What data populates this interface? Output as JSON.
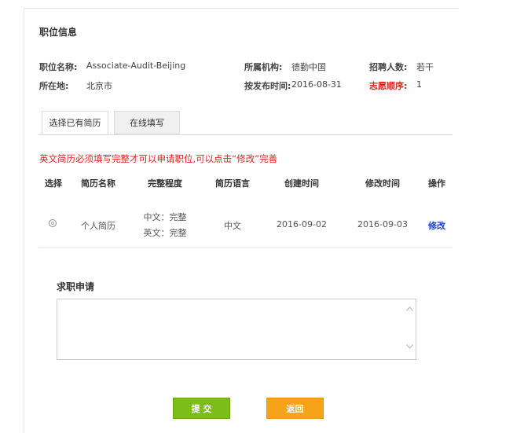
{
  "position_info": {
    "title": "职位信息",
    "name_label": "职位名称:",
    "name_value": "Associate-Audit-Beijing",
    "org_label": "所属机构:",
    "org_value": "德勤中国",
    "headcount_label": "招聘人数:",
    "headcount_value": "若干",
    "location_label": "所在地:",
    "location_value": "北京市",
    "publish_label": "按发布时间:",
    "publish_value": "2016-08-31",
    "preference_label": "志愿顺序:",
    "preference_value": "1"
  },
  "tabs": [
    {
      "label": "选择已有简历",
      "active": true
    },
    {
      "label": "在线填写",
      "active": false
    }
  ],
  "notice": "英文简历必须填写完整才可以申请职位,可以点击“修改”完善",
  "resume_table": {
    "headers": [
      "选择",
      "简历名称",
      "完整程度",
      "简历语言",
      "创建时间",
      "修改时间",
      "操作"
    ],
    "rows": [
      {
        "name": "个人简历",
        "completeness_cn": "中文：完整",
        "completeness_en": "英文：完整",
        "language": "中文",
        "created": "2016-09-02",
        "modified": "2016-09-03",
        "action": "修改"
      }
    ]
  },
  "application": {
    "title": "求职申请",
    "text": ""
  },
  "buttons": {
    "submit": "提 交",
    "back": "返回"
  },
  "icons": {
    "scroll_up": "chevron-up-icon",
    "scroll_down": "chevron-down-icon"
  },
  "colors": {
    "accent_red": "#e02222",
    "submit_green": "#7cbd1a",
    "back_orange": "#f7a21b",
    "link_blue": "#1a3fd6"
  }
}
